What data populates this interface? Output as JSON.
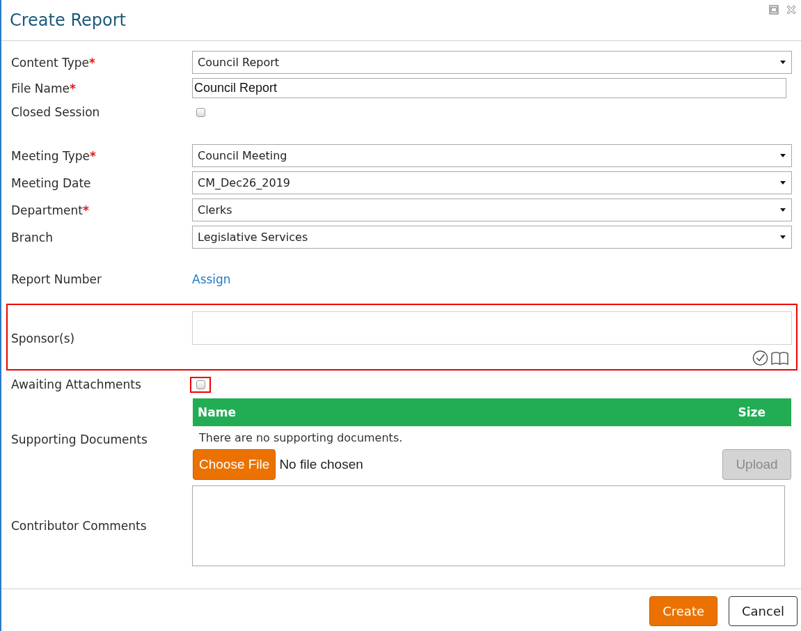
{
  "dialog": {
    "title": "Create Report"
  },
  "groups": [
    {
      "fields": [
        {
          "kind": "select",
          "label": "Content Type",
          "required_mark": "*",
          "value": "Council Report",
          "highlighted": false
        },
        {
          "kind": "text",
          "label": "File Name",
          "required_mark": "*",
          "value": "Council Report",
          "highlighted": false
        },
        {
          "kind": "checkbox",
          "label": "Closed Session",
          "checked": false,
          "highlighted": false
        }
      ]
    },
    {
      "fields": [
        {
          "kind": "select",
          "label": "Meeting Type",
          "required_mark": "*",
          "value": "Council Meeting",
          "highlighted": false
        },
        {
          "kind": "select",
          "label": "Meeting Date",
          "value": "CM_Dec26_2019",
          "highlighted": false
        },
        {
          "kind": "select",
          "label": "Department",
          "required_mark": "*",
          "value": "Clerks",
          "highlighted": false
        },
        {
          "kind": "select",
          "label": "Branch",
          "value": "Legislative Services",
          "highlighted": false
        }
      ]
    },
    {
      "fields": [
        {
          "kind": "link",
          "label": "Report Number",
          "link": "Assign",
          "highlighted": false
        },
        {
          "kind": "lookup",
          "label": "Sponsor(s)",
          "highlighted": true
        },
        {
          "kind": "checkbox",
          "label": "Awaiting Attachments",
          "checked": false,
          "highlighted": true
        },
        {
          "kind": "attachments",
          "label": "Supporting Documents",
          "columns": [
            "Name",
            "Size"
          ],
          "empty_text": "There are no supporting documents.",
          "file_button": "Choose File",
          "file_status": "No file chosen",
          "upload": {
            "label": "Upload",
            "disabled": true
          },
          "highlighted": false
        },
        {
          "kind": "textarea",
          "label": "Contributor Comments",
          "highlighted": false
        }
      ]
    }
  ],
  "buttons": [
    {
      "label": "Create",
      "kind": "primary"
    },
    {
      "label": "Cancel",
      "kind": "secondary"
    }
  ]
}
